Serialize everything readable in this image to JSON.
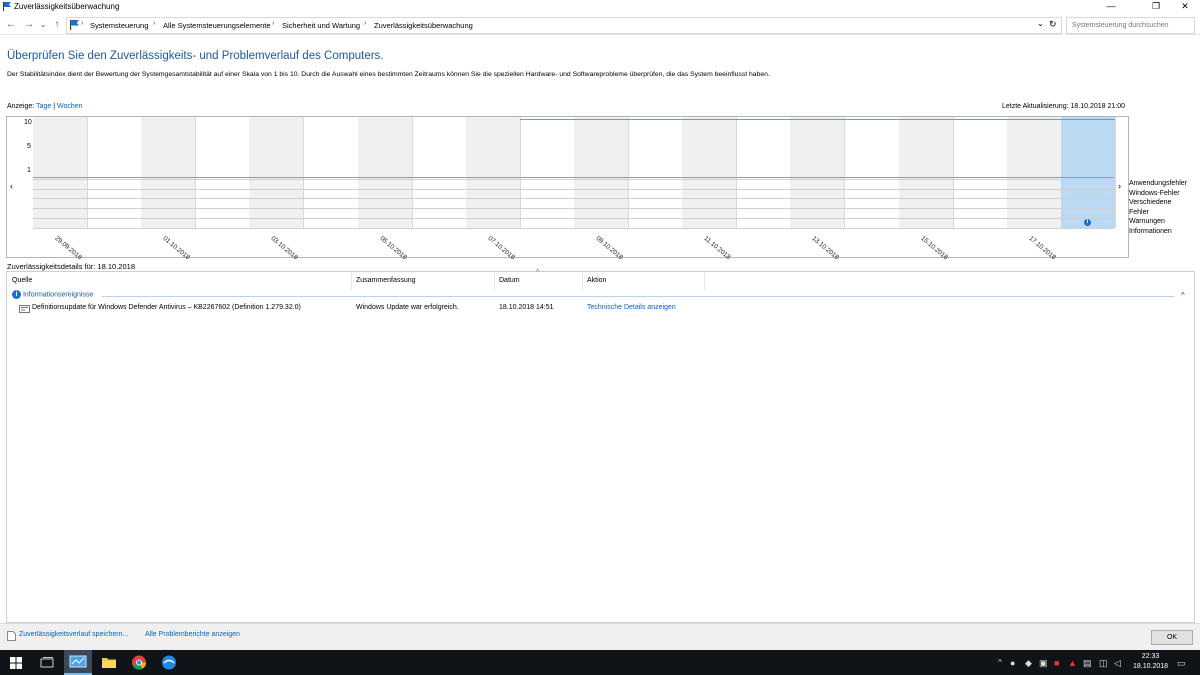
{
  "window": {
    "title": "Zuverlässigkeitsüberwachung",
    "minimize": "—",
    "restore": "❐",
    "close": "✕"
  },
  "nav": {
    "back": "←",
    "forward": "→",
    "recent": "⌄",
    "up": "↑"
  },
  "breadcrumb": {
    "items": [
      "Systemsteuerung",
      "Alle Systemsteuerungselemente",
      "Sicherheit und Wartung",
      "Zuverlässigkeitsüberwachung"
    ],
    "refresh": "↻",
    "dropdown": "⌄"
  },
  "search": {
    "placeholder": "Systemsteuerung durchsuchen"
  },
  "main": {
    "heading": "Überprüfen Sie den Zuverlässigkeits- und Problemverlauf des Computers.",
    "description": "Der Stabilitätsindex dient der Bewertung der Systemgesamtstabilität auf einer Skala von 1 bis 10. Durch die Auswahl eines bestimmten Zeitraums können Sie die speziellen Hardware- und Softwareprobleme überprüfen, die das System beeinflusst haben.",
    "view_label": "Anzeige:",
    "view_days": "Tage",
    "view_divider": "|",
    "view_weeks": "Wochen",
    "last_update": "Letzte Aktualisierung: 18.10.2018 21:00"
  },
  "chart_data": {
    "type": "line",
    "y_ticks": [
      "10",
      "5",
      "1"
    ],
    "ylim": [
      1,
      10
    ],
    "x_labels": [
      "29.09.2018",
      "01.10.2018",
      "03.10.2018",
      "05.10.2018",
      "07.10.2018",
      "09.10.2018",
      "11.10.2018",
      "13.10.2018",
      "15.10.2018",
      "17.10.2018"
    ],
    "columns": 20,
    "stability_start_column": 9,
    "stability_value": 10,
    "selected_column": 19,
    "nav_left": "‹",
    "nav_right": "›",
    "legend": [
      "Anwendungsfehler",
      "Windows-Fehler",
      "Verschiedene Fehler",
      "Warnungen",
      "Informationen"
    ],
    "events": [
      {
        "column": 19,
        "row": "Informationen",
        "icon": "info-icon",
        "symbol": "i"
      }
    ],
    "line_color": "#6a9bd0",
    "selected_color": "#bcd9f3"
  },
  "details": {
    "label": "Zuverlässigkeitsdetails für: 18.10.2018",
    "sort_indicator": "^",
    "columns": [
      "Quelle",
      "Zusammenfassung",
      "Datum",
      "Aktion"
    ],
    "group": {
      "icon": "i",
      "label": "Informationsereignisse",
      "collapse": "^"
    },
    "rows": [
      {
        "source": "Definitionsupdate für Windows Defender Antivirus – KB2267602 (Definition 1.279.32.0)",
        "summary": "Windows Update war erfolgreich.",
        "date": "18.10.2018 14:51",
        "action": "Technische Details anzeigen"
      }
    ]
  },
  "footer": {
    "save_history": "Zuverlässigkeitsverlauf speichern...",
    "all_reports": "Alle Problemberichte anzeigen",
    "ok": "OK"
  },
  "taskbar": {
    "time": "22:33",
    "date": "18.10.2018",
    "tray_chevron": "^"
  }
}
